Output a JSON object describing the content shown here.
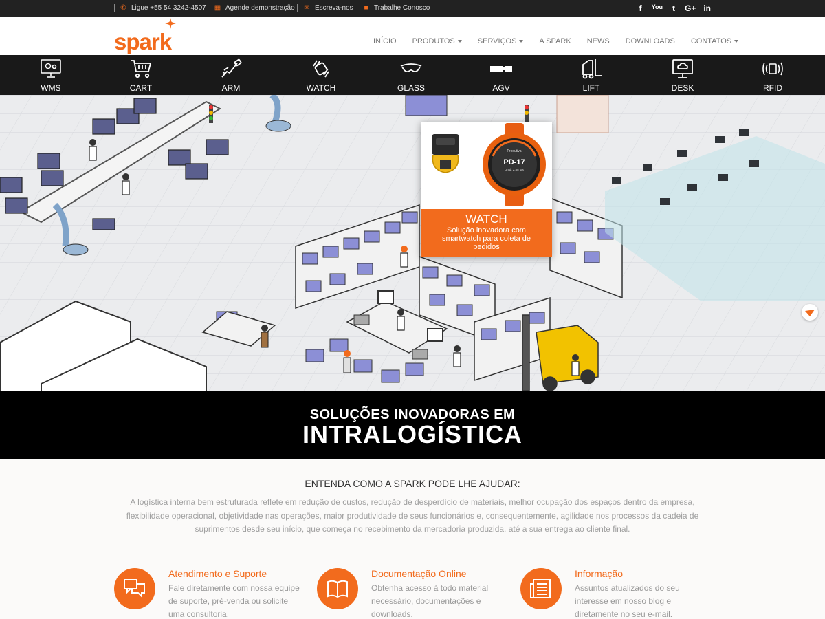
{
  "topbar": {
    "phone": "Ligue +55 54 3242-4507",
    "demo": "Agende demonstração",
    "write": "Escreva-nos",
    "jobs": "Trabalhe Conosco",
    "social": [
      "f",
      "You",
      "t",
      "G+",
      "in"
    ]
  },
  "brand": {
    "name": "spark",
    "accent": "#f26b1d"
  },
  "nav": {
    "inicio": "INÍCIO",
    "produtos": "PRODUTOS",
    "servicos": "SERVIÇOS",
    "aspark": "A SPARK",
    "news": "NEWS",
    "downloads": "DOWNLOADS",
    "contatos": "CONTATOS"
  },
  "categories": [
    {
      "label": "WMS",
      "icon": "monitor-gears-icon"
    },
    {
      "label": "CART",
      "icon": "cart-icon"
    },
    {
      "label": "ARM",
      "icon": "arm-icon"
    },
    {
      "label": "WATCH",
      "icon": "watch-icon"
    },
    {
      "label": "GLASS",
      "icon": "glasses-icon"
    },
    {
      "label": "AGV",
      "icon": "agv-icon"
    },
    {
      "label": "LIFT",
      "icon": "forklift-icon"
    },
    {
      "label": "DESK",
      "icon": "desk-cloud-icon"
    },
    {
      "label": "RFID",
      "icon": "rfid-icon"
    }
  ],
  "popup": {
    "title": "WATCH",
    "text": "Solução inovadora com smartwatch para coleta de pedidos",
    "watch_brand": "Produtiva",
    "watch_code": "PD-17",
    "watch_sub": "Unid: 2,58 u/s"
  },
  "banner": {
    "line1": "SOLUÇÕES INOVADORAS EM",
    "line2": "INTRALOGÍSTICA"
  },
  "intro": {
    "heading": "ENTENDA COMO A SPARK PODE LHE AJUDAR:",
    "text": "A logística interna bem estruturada reflete em redução de custos, redução de desperdício de materiais, melhor ocupação dos espaços dentro da empresa, flexibilidade operacional, objetividade nas operações, maior produtividade de seus funcionários e, consequentemente, agilidade nos processos da cadeia de suprimentos desde seu início, que começa no recebimento da mercadoria produzida, até a sua entrega ao cliente final."
  },
  "features": [
    {
      "title": "Atendimento e Suporte",
      "text": "Fale diretamente com nossa equipe de suporte, pré-venda ou solicite uma consultoria.",
      "icon": "chat-bubbles-icon"
    },
    {
      "title": "Documentação Online",
      "text": "Obtenha acesso à todo material necessário, documentações e downloads.",
      "icon": "book-icon"
    },
    {
      "title": "Informação",
      "text": "Assuntos atualizados do seu interesse em nosso blog e diretamente no seu e-mail.",
      "icon": "newspaper-icon"
    }
  ]
}
